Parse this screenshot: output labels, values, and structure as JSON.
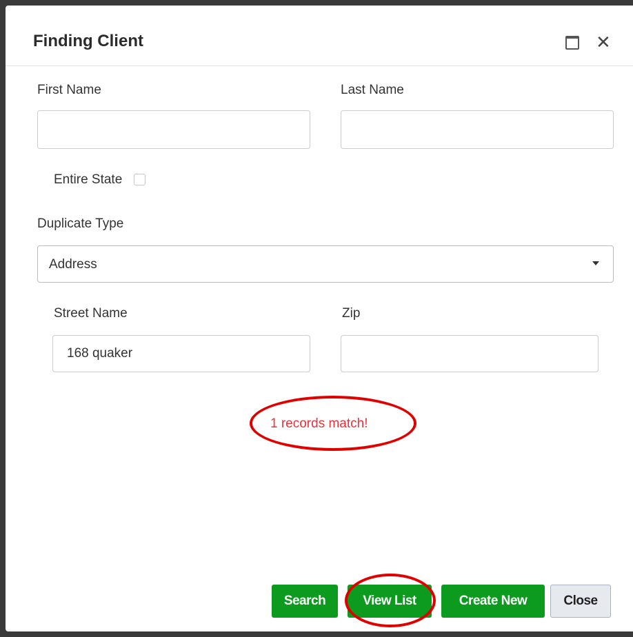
{
  "dialog": {
    "title": "Finding Client"
  },
  "form": {
    "first_name": {
      "label": "First Name",
      "value": ""
    },
    "last_name": {
      "label": "Last Name",
      "value": ""
    },
    "entire_state": {
      "label": "Entire State",
      "checked": false
    },
    "duplicate_type": {
      "label": "Duplicate Type",
      "selected": "Address"
    },
    "street_name": {
      "label": "Street Name",
      "value": "168 quaker"
    },
    "zip": {
      "label": "Zip",
      "value": ""
    }
  },
  "status": {
    "match_text": "1 records match!",
    "color": "#e8323c"
  },
  "buttons": {
    "search": "Search",
    "view_list": "View List",
    "create_new": "Create New",
    "close": "Close"
  },
  "colors": {
    "primary_button": "#0d9b1f",
    "annotation": "#e00000"
  },
  "icons": {
    "maximize": "maximize-icon",
    "close": "close-icon",
    "dropdown": "caret-down-icon"
  }
}
